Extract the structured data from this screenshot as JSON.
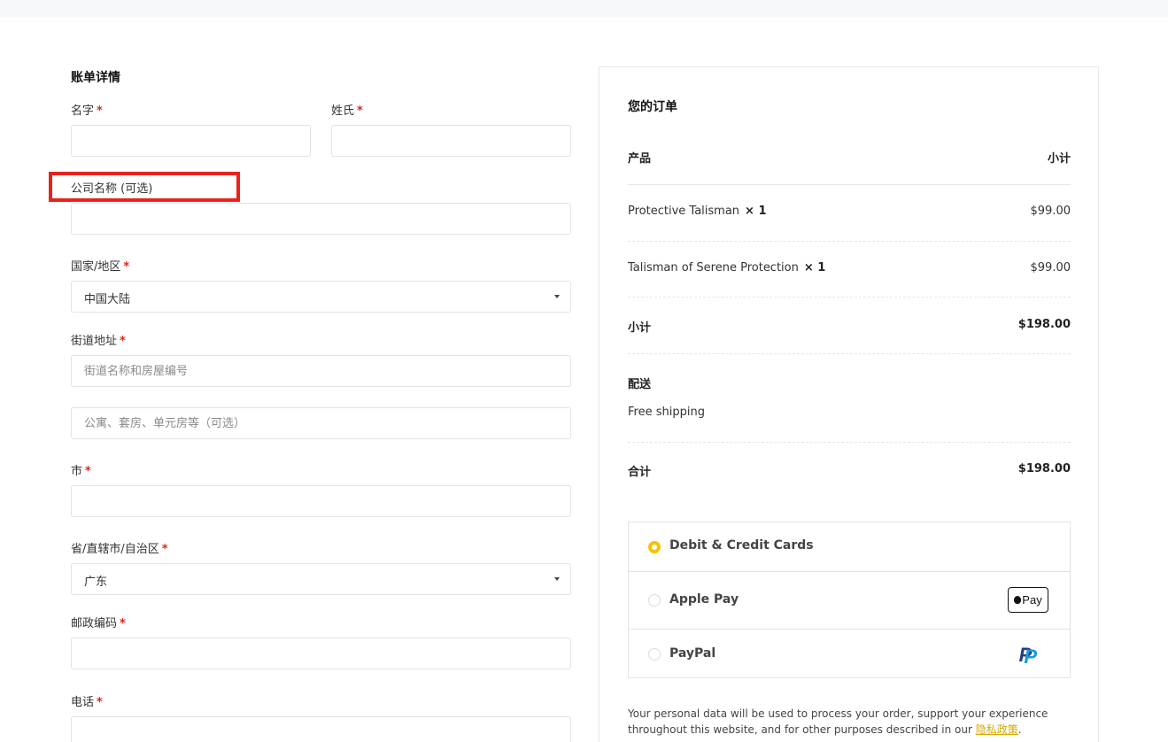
{
  "billing": {
    "title": "账单详情",
    "first_name_label": "名字",
    "last_name_label": "姓氏",
    "company_label": "公司名称 (可选)",
    "country_label": "国家/地区",
    "country_value": "中国大陆",
    "street_label": "街道地址",
    "street1_placeholder": "街道名称和房屋编号",
    "street2_placeholder": "公寓、套房、单元房等（可选）",
    "city_label": "市",
    "province_label": "省/直辖市/自治区",
    "province_value": "广东",
    "postcode_label": "邮政编码",
    "phone_label": "电话",
    "required_mark": "*"
  },
  "order": {
    "title": "您的订单",
    "col_product": "产品",
    "col_subtotal": "小计",
    "items": [
      {
        "name": "Protective Talisman",
        "qty": "× 1",
        "price": "$99.00"
      },
      {
        "name": "Talisman of Serene Protection",
        "qty": "× 1",
        "price": "$99.00"
      }
    ],
    "subtotal_label": "小计",
    "subtotal_value": "$198.00",
    "shipping_label": "配送",
    "shipping_value": "Free shipping",
    "total_label": "合计",
    "total_value": "$198.00"
  },
  "payment": {
    "options": [
      {
        "label": "Debit & Credit Cards",
        "selected": true
      },
      {
        "label": "Apple Pay",
        "selected": false,
        "badge": "Pay"
      },
      {
        "label": "PayPal",
        "selected": false,
        "icon": "paypal-icon"
      }
    ]
  },
  "privacy": {
    "text": "Your personal data will be used to process your order, support your experience throughout this website, and for other purposes described in our ",
    "link": "隐私政策",
    "suffix": "."
  },
  "colors": {
    "required": "#e2231a",
    "accent": "#f5c400",
    "highlight": "#e8231b"
  }
}
